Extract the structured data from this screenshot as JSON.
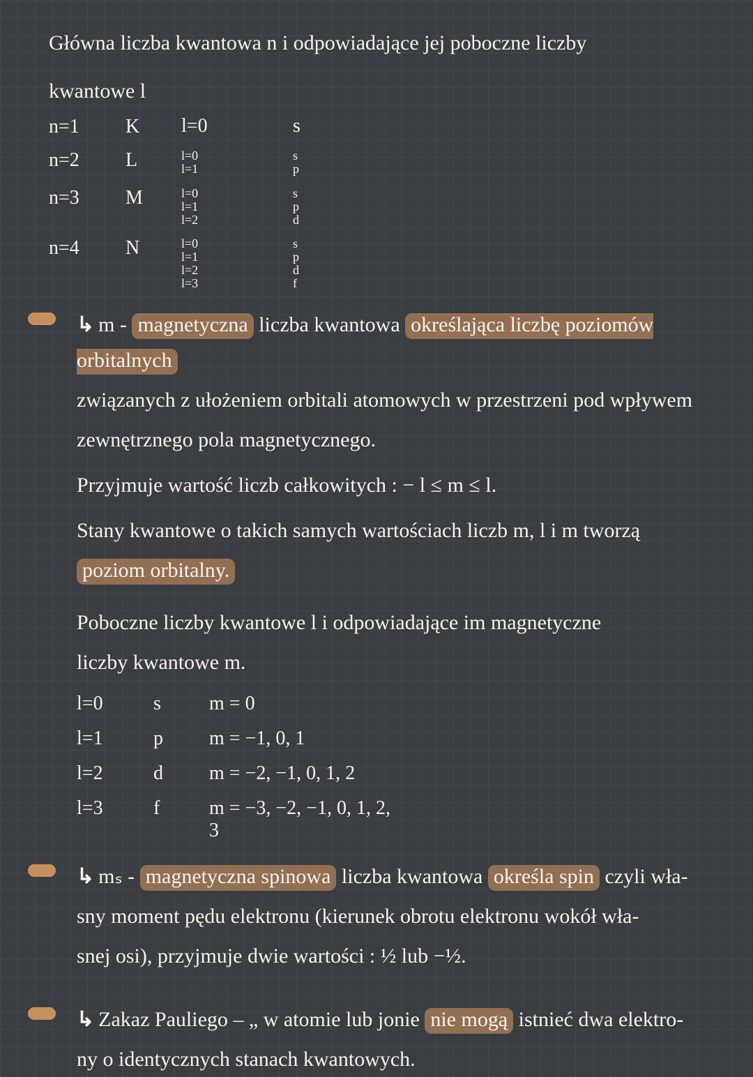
{
  "title1": "Główna liczba kwantowa n i odpowiadające jej poboczne liczby",
  "title1b": "kwantowe l",
  "table1": [
    {
      "n": "n=1",
      "shell": "K",
      "l": [
        "l=0"
      ],
      "orb": [
        "s"
      ]
    },
    {
      "n": "n=2",
      "shell": "L",
      "l": [
        "l=0",
        "l=1"
      ],
      "orb": [
        "s",
        "p"
      ]
    },
    {
      "n": "n=3",
      "shell": "M",
      "l": [
        "l=0",
        "l=1",
        "l=2"
      ],
      "orb": [
        "s",
        "p",
        "d"
      ]
    },
    {
      "n": "n=4",
      "shell": "N",
      "l": [
        "l=0",
        "l=1",
        "l=2",
        "l=3"
      ],
      "orb": [
        "s",
        "p",
        "d",
        "f"
      ]
    }
  ],
  "m_label": "m - ",
  "m_hl": "magnetyczna",
  "m_text_a": " liczba kwantowa ",
  "m_hl2": "określająca liczbę poziomów orbitalnych",
  "m_line2": "związanych z ułożeniem orbitali atomowych w przestrzeni pod wpływem",
  "m_line3": "zewnętrznego pola magnetycznego.",
  "m_range": "Przyjmuje wartość liczb całkowitych : − l ≤ m ≤ l.",
  "m_states": "Stany kwantowe o takich samych wartościach liczb m, l i m tworzą",
  "m_level_hl": "poziom orbitalny.",
  "title2a": "Poboczne liczby kwantowe l i odpowiadające im magnetyczne",
  "title2b": "liczby kwantowe m.",
  "table2": [
    {
      "l": "l=0",
      "orb": "s",
      "m": "m = 0"
    },
    {
      "l": "l=1",
      "orb": "p",
      "m": "m = −1, 0, 1"
    },
    {
      "l": "l=2",
      "orb": "d",
      "m": "m = −2, −1, 0, 1, 2"
    },
    {
      "l": "l=3",
      "orb": "f",
      "m": "m = −3, −2, −1, 0, 1, 2, 3"
    }
  ],
  "ms_label": "mₛ - ",
  "ms_hl": "magnetyczna spinowa",
  "ms_text": " liczba kwantowa ",
  "ms_hl2": "określa spin",
  "ms_tail": " czyli wła-",
  "ms_line2": "sny moment pędu elektronu (kierunek obrotu elektronu wokół wła-",
  "ms_line3": "snej osi), przyjmuje dwie wartości : ½ lub −½.",
  "pauli_label": "Zakaz Pauliego",
  "pauli_text": " – „ w atomie lub jonie ",
  "pauli_hl": "nie mogą",
  "pauli_tail": " istnieć dwa elektro-",
  "pauli_line2": "ny o identycznych stanach kwantowych."
}
